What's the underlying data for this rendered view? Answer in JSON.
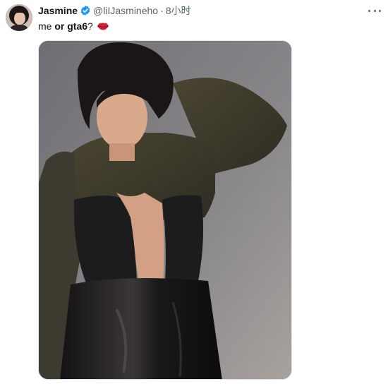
{
  "tweet": {
    "author": {
      "display_name": "Jasmine",
      "handle": "@liIJasmineho",
      "verified": true,
      "avatar_icon": "user-avatar"
    },
    "separator": "·",
    "timestamp": "8小时",
    "text": {
      "part1": "me",
      "part2": "or gta6",
      "part3": "?",
      "emoji_icon": "kiss-mark-icon"
    },
    "media": {
      "type": "photo",
      "content_icon": "photo"
    },
    "more_icon": "more-icon"
  },
  "colors": {
    "verified_badge": "#1d9bf0",
    "secondary_text": "#536471",
    "primary_text": "#0f1419",
    "lips": "#d2243c"
  }
}
